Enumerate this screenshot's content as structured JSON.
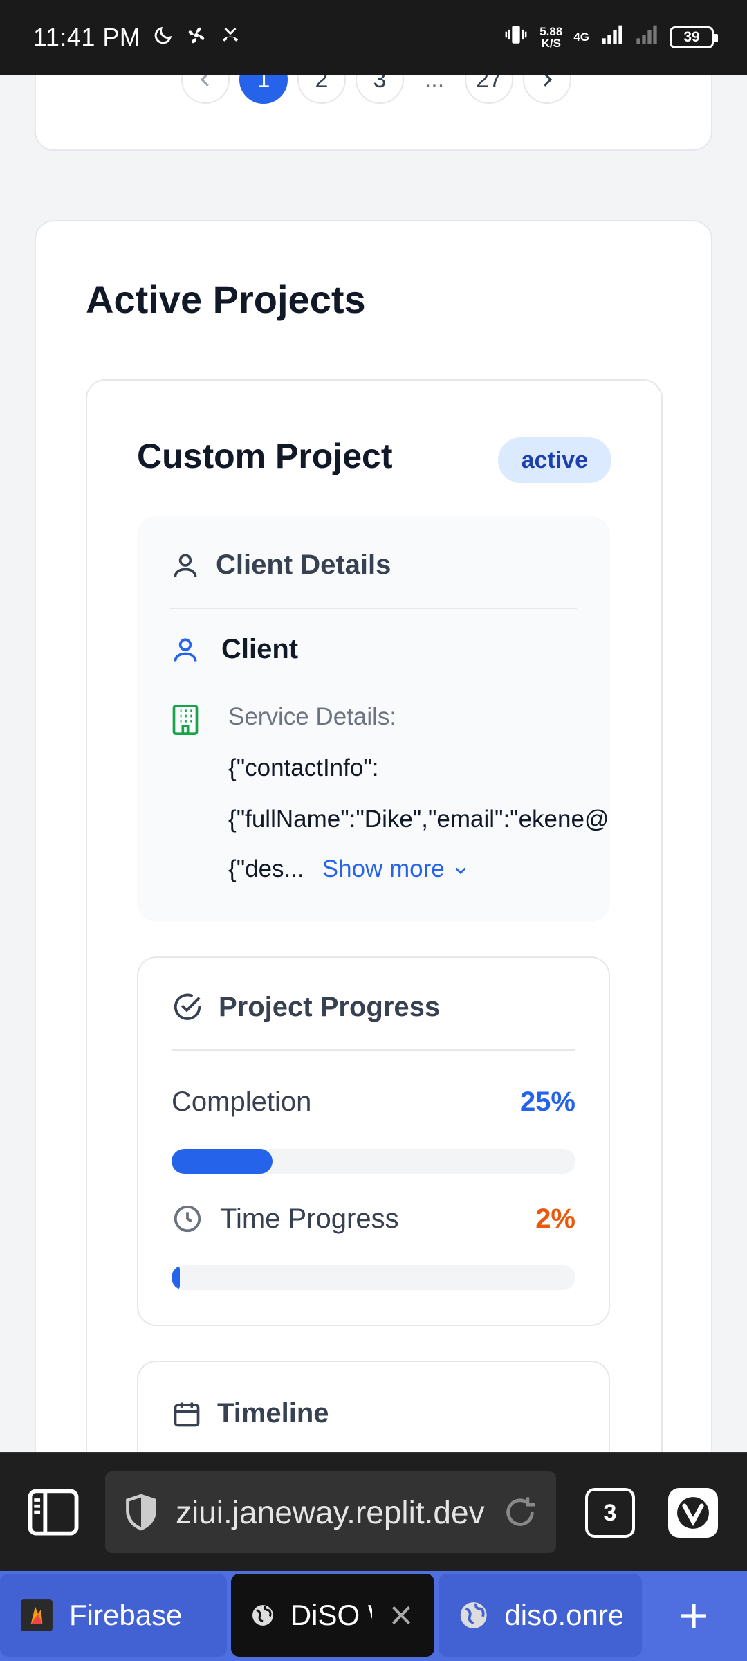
{
  "status_bar": {
    "time": "11:41 PM",
    "speed_value": "5.88",
    "speed_unit": "K/S",
    "network": "4G",
    "battery": "39"
  },
  "pagination": {
    "pages": [
      "1",
      "2",
      "3",
      "...",
      "27"
    ],
    "active_page": "1"
  },
  "active_projects": {
    "title": "Active Projects",
    "project": {
      "title": "Custom Project",
      "status": "active",
      "client_details": {
        "heading": "Client Details",
        "client_label": "Client",
        "service_label": "Service Details:",
        "service_lines": [
          "{\"contactInfo\":",
          "{\"fullName\":\"Dike\",\"email\":\"ekene@gmail.com\",\"p",
          "{\"des..."
        ],
        "show_more": "Show more"
      },
      "progress": {
        "heading": "Project Progress",
        "completion_label": "Completion",
        "completion_value": "25%",
        "completion_fraction": 0.25,
        "time_label": "Time Progress",
        "time_value": "2%",
        "time_fraction": 0.02
      },
      "timeline": {
        "heading": "Timeline"
      }
    }
  },
  "browser": {
    "url": "ziui.janeway.replit.dev",
    "tab_count": "3",
    "tabs": [
      {
        "label": "Firebase"
      },
      {
        "label": "DiSO W"
      },
      {
        "label": "diso.onre"
      }
    ]
  },
  "colors": {
    "accent": "#2563eb",
    "badge_bg": "#dbeafe",
    "time_value": "#ea580c",
    "building_icon": "#16a34a",
    "tabstrip": "#4f6fe0"
  }
}
